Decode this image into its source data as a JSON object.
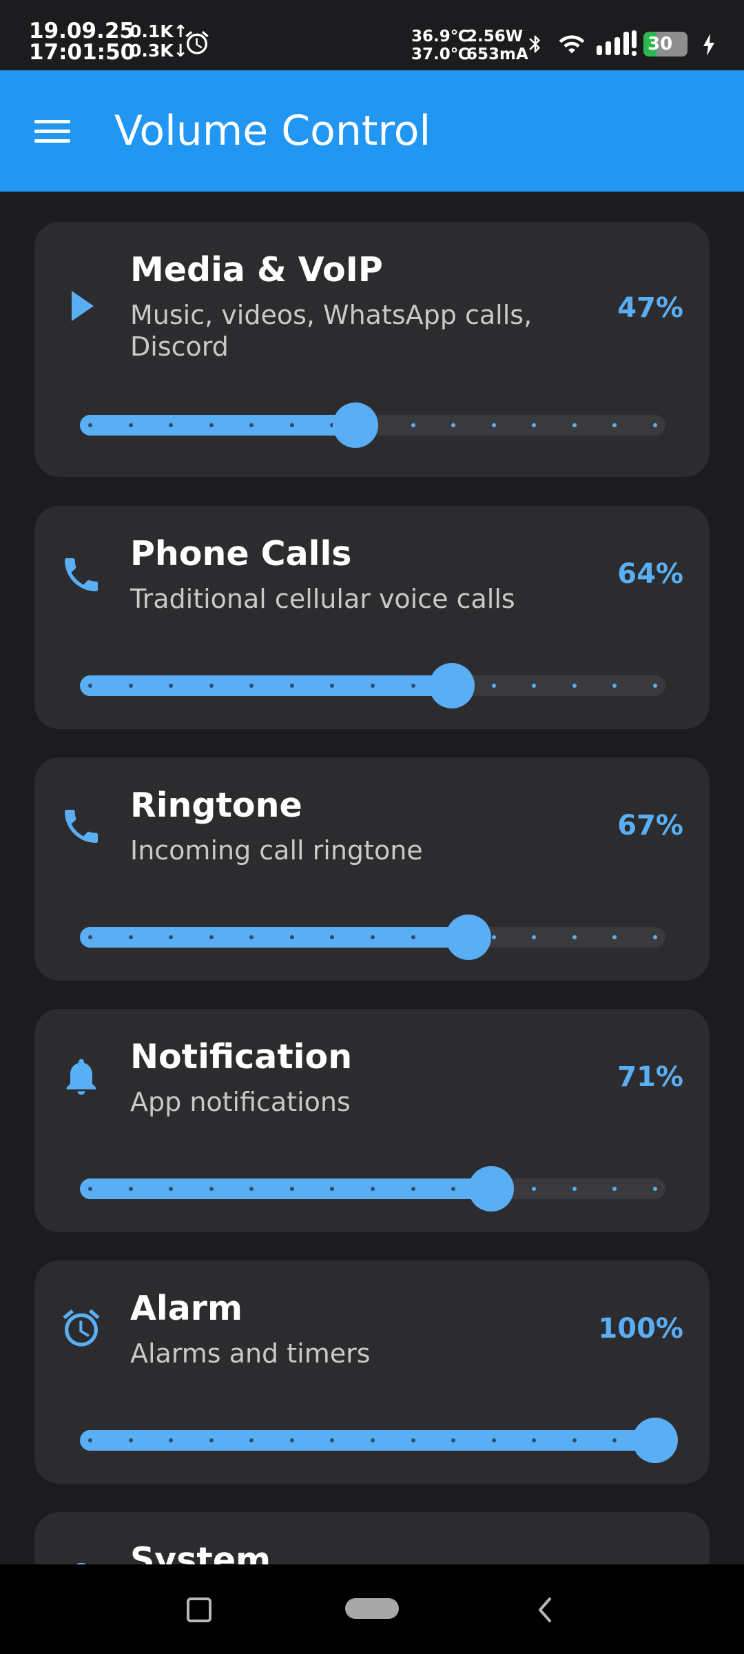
{
  "status_bar": {
    "date": "19.09.25",
    "time": "17:01:50",
    "net_up": "0.1K↑",
    "net_down": "0.3K↓",
    "temp_battery": "36.9℃",
    "temp_cpu": "37.0℃",
    "power": "2.56W",
    "current": "653mA",
    "battery_percent": "30",
    "battery_level": 0.3,
    "icons": [
      "alarm-icon",
      "bluetooth-icon",
      "wifi-icon",
      "signal-icon",
      "battery-icon",
      "charging-icon"
    ]
  },
  "app_bar": {
    "title": "Volume Control",
    "menu_icon": "hamburger-menu-icon",
    "color": "#2196f3"
  },
  "theme": {
    "accent": "#5aaef4",
    "card_bg": "#2c2c2e",
    "page_bg": "#1c1c1f"
  },
  "streams": [
    {
      "id": "media",
      "icon": "play-icon",
      "title": "Media & VoIP",
      "description": "Music, videos, WhatsApp calls, Discord",
      "value_label": "47%",
      "level": 0.47
    },
    {
      "id": "phone",
      "icon": "phone-icon",
      "title": "Phone Calls",
      "description": "Traditional cellular voice calls",
      "value_label": "64%",
      "level": 0.64
    },
    {
      "id": "ringtone",
      "icon": "phone-icon",
      "title": "Ringtone",
      "description": "Incoming call ringtone",
      "value_label": "67%",
      "level": 0.67
    },
    {
      "id": "notification",
      "icon": "bell-icon",
      "title": "Notification",
      "description": "App notifications",
      "value_label": "71%",
      "level": 0.71
    },
    {
      "id": "alarm",
      "icon": "alarm-clock-icon",
      "title": "Alarm",
      "description": "Alarms and timers",
      "value_label": "100%",
      "level": 1.0
    },
    {
      "id": "system",
      "icon": "system-icon",
      "title": "System",
      "description": "",
      "value_label": "",
      "level": null
    }
  ],
  "nav_bar": {
    "buttons": [
      "recents-button",
      "home-button",
      "back-button"
    ]
  }
}
